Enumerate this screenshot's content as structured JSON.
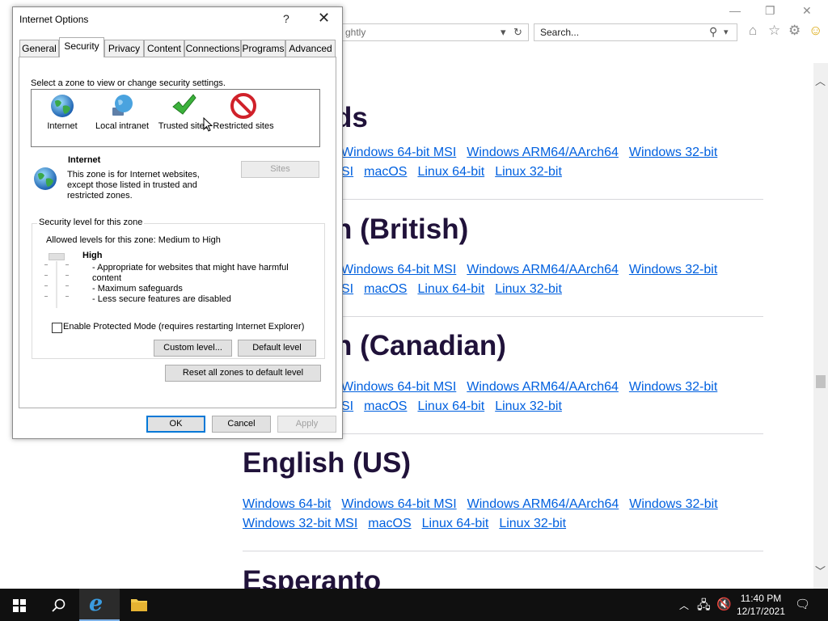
{
  "browser": {
    "address_partial": "ghtly",
    "search_placeholder": "Search...",
    "icons": [
      "home-icon",
      "star-icon",
      "gear-icon",
      "smiley-icon"
    ]
  },
  "page": {
    "partial_title_1": "ds",
    "languages": [
      {
        "title": "h (British)",
        "row1": [
          "Windows 64-bit MSI",
          "Windows ARM64/AArch64",
          "Windows 32-bit"
        ],
        "row2": [
          "SI",
          "macOS",
          "Linux 64-bit",
          "Linux 32-bit"
        ]
      },
      {
        "title": "h (Canadian)",
        "row1": [
          "Windows 64-bit MSI",
          "Windows ARM64/AArch64",
          "Windows 32-bit"
        ],
        "row2": [
          "SI",
          "macOS",
          "Linux 64-bit",
          "Linux 32-bit"
        ]
      },
      {
        "title": "English (US)",
        "row1": [
          "Windows 64-bit",
          "Windows 64-bit MSI",
          "Windows ARM64/AArch64",
          "Windows 32-bit"
        ],
        "row2": [
          "Windows 32-bit MSI",
          "macOS",
          "Linux 64-bit",
          "Linux 32-bit"
        ]
      },
      {
        "title": "Esperanto"
      }
    ],
    "first_block": {
      "row1": [
        "Windows 64-bit MSI",
        "Windows ARM64/AArch64",
        "Windows 32-bit"
      ],
      "row2": [
        "SI",
        "macOS",
        "Linux 64-bit",
        "Linux 32-bit"
      ]
    }
  },
  "dialog": {
    "title": "Internet Options",
    "help": "?",
    "close": "✕",
    "tabs": [
      "General",
      "Security",
      "Privacy",
      "Content",
      "Connections",
      "Programs",
      "Advanced"
    ],
    "active_tab": "Security",
    "select_zone_text": "Select a zone to view or change security settings.",
    "zones": [
      {
        "label": "Internet",
        "icon": "globe-icon"
      },
      {
        "label": "Local intranet",
        "icon": "intranet-globe-icon"
      },
      {
        "label": "Trusted sites",
        "icon": "checkmark-icon"
      },
      {
        "label": "Restricted sites",
        "icon": "no-entry-icon"
      }
    ],
    "zone_name": "Internet",
    "zone_desc": "This zone is for Internet websites, except those listed in trusted and restricted zones.",
    "sites_button": "Sites",
    "security_group_title": "Security level for this zone",
    "allowed_levels": "Allowed levels for this zone: Medium to High",
    "level_name": "High",
    "level_bullets": [
      "- Appropriate for websites that might have harmful content",
      "- Maximum safeguards",
      "- Less secure features are disabled"
    ],
    "protected_mode_label": "Enable Protected Mode (requires restarting Internet Explorer)",
    "protected_mode_checked": false,
    "custom_level_button": "Custom level...",
    "default_level_button": "Default level",
    "reset_all_button": "Reset all zones to default level",
    "ok_button": "OK",
    "cancel_button": "Cancel",
    "apply_button": "Apply"
  },
  "taskbar": {
    "time": "11:40 PM",
    "date": "12/17/2021"
  },
  "colors": {
    "link": "#0060df",
    "heading": "#20123a",
    "taskbar": "#101010",
    "focus": "#0078d7"
  }
}
